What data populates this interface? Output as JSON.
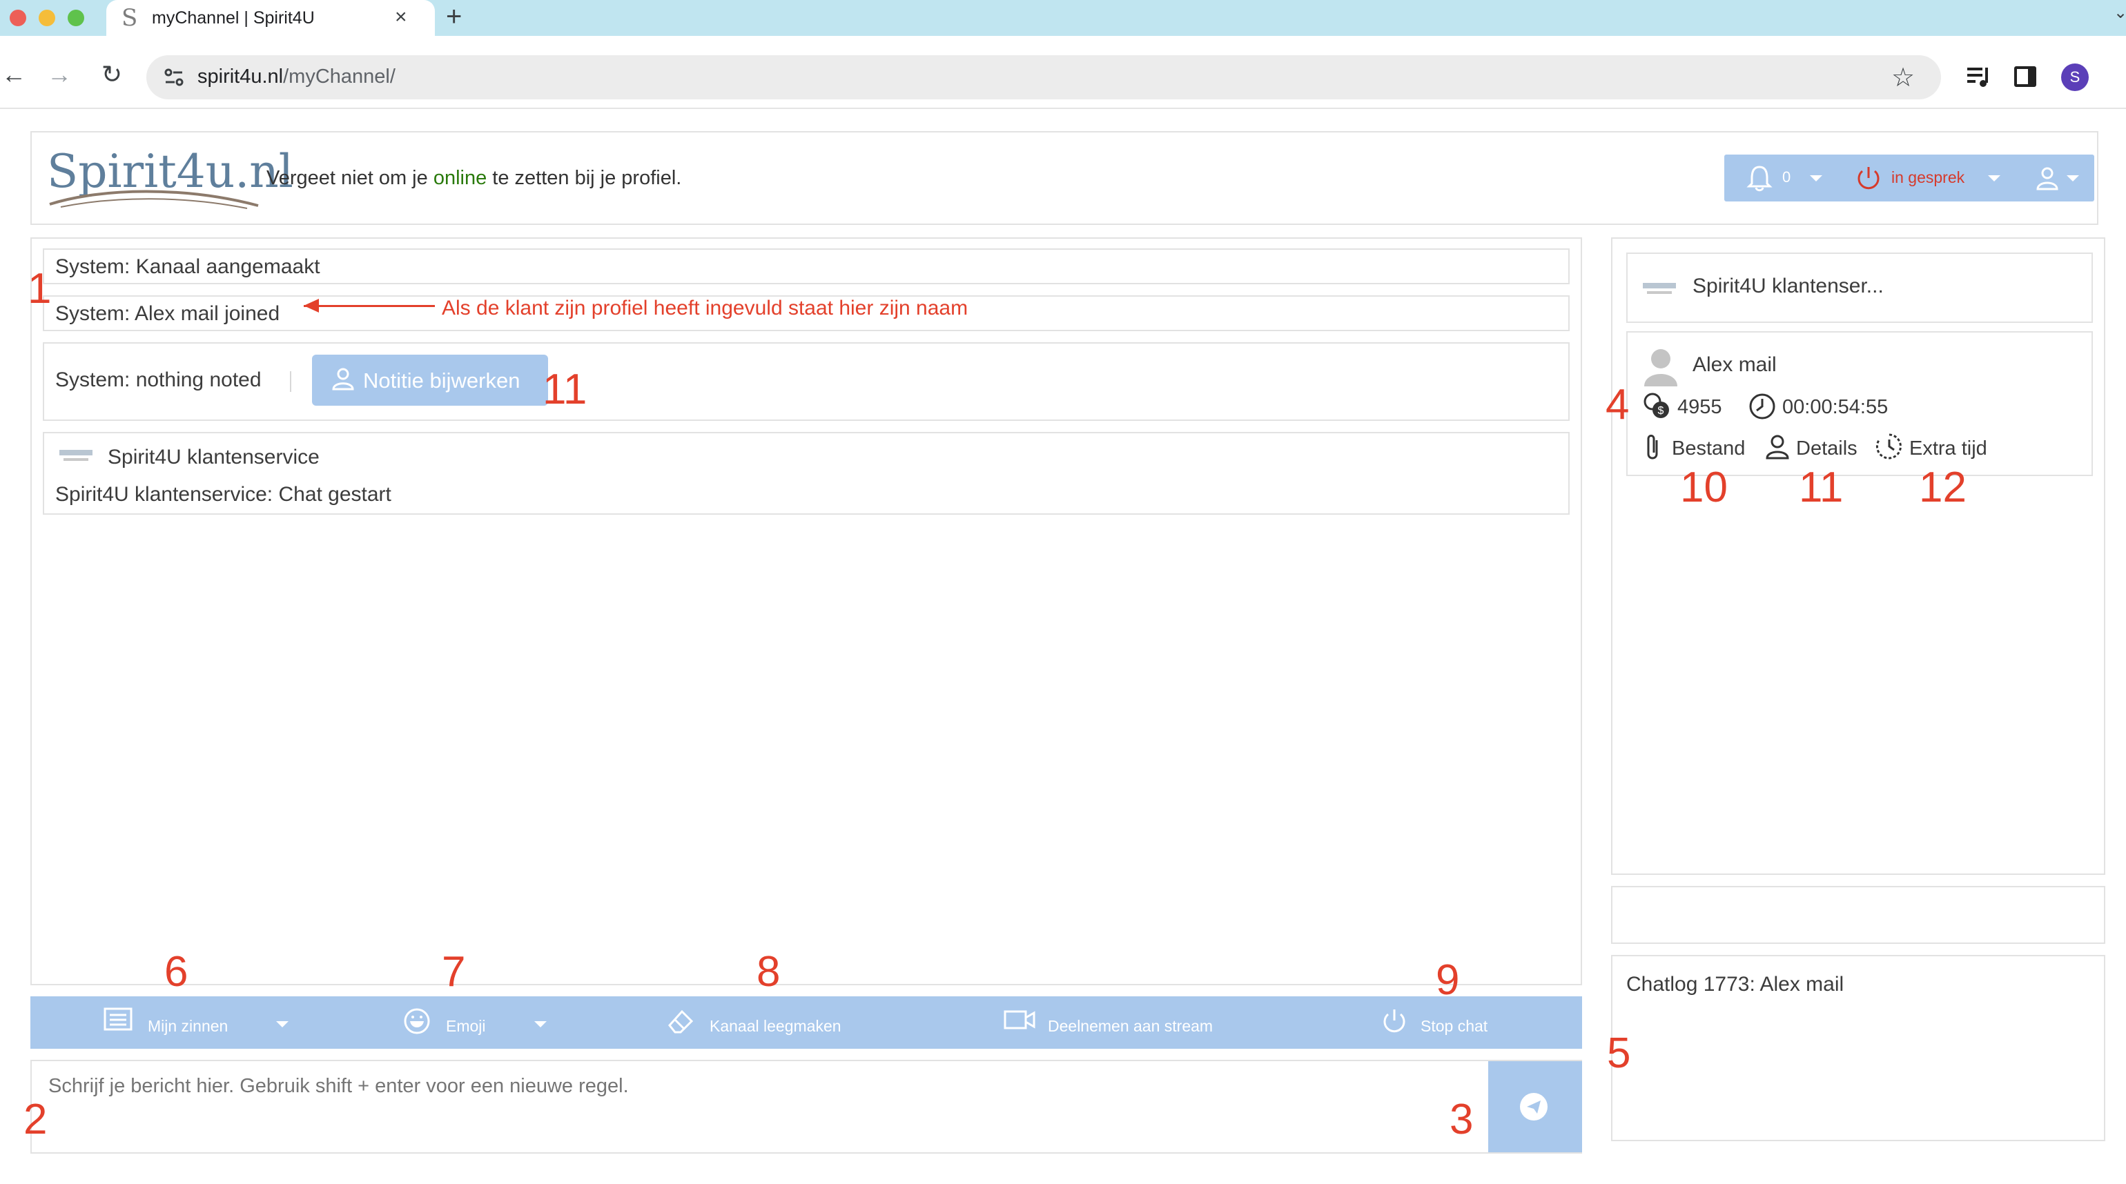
{
  "browser": {
    "tab_favicon": "S",
    "tab_title": "myChannel | Spirit4U",
    "tab_close": "×",
    "new_tab": "+",
    "url_host": "spirit4u.nl",
    "url_path": "/myChannel/",
    "profile_initial": "S"
  },
  "header": {
    "logo_text": "Spirit4u.nl",
    "notice_before": "Vergeet niet om je ",
    "notice_online": "online",
    "notice_after": " te zetten bij je profiel.",
    "notification_count": "0",
    "status_label": "in gesprek"
  },
  "chat": {
    "messages": [
      {
        "text": "System: Kanaal aangemaakt"
      },
      {
        "text": "System: Alex mail joined"
      },
      {
        "text": "System: nothing noted"
      },
      {
        "sender": "Spirit4U klantenservice",
        "text": "Spirit4U klantenservice: Chat gestart"
      }
    ],
    "note_button_label": "Notitie bijwerken",
    "arrow_note": "Als de klant zijn profiel heeft ingevuld staat hier zijn naam"
  },
  "action_bar": {
    "my_phrases": "Mijn zinnen",
    "emoji": "Emoji",
    "clear_channel": "Kanaal leegmaken",
    "join_stream": "Deelnemen aan stream",
    "stop_chat": "Stop chat"
  },
  "composer": {
    "placeholder": "Schrijf je bericht hier. Gebruik shift + enter voor een nieuwe regel."
  },
  "sidebar": {
    "agent_name": "Spirit4U klantenser...",
    "client_name": "Alex mail",
    "credits": "4955",
    "duration": "00:00:54:55",
    "file_label": "Bestand",
    "details_label": "Details",
    "extra_time_label": "Extra tijd",
    "chatlog_title": "Chatlog 1773: Alex mail"
  },
  "annotations": [
    "1",
    "2",
    "3",
    "4",
    "5",
    "6",
    "7",
    "8",
    "9",
    "10",
    "11",
    "11",
    "12"
  ],
  "colors": {
    "accent_blue": "#a9c8ec",
    "annotation_red": "#e3402b",
    "online_green": "#2a7a0c",
    "status_red": "#d63a2b",
    "tab_strip": "#c0e5f0"
  }
}
